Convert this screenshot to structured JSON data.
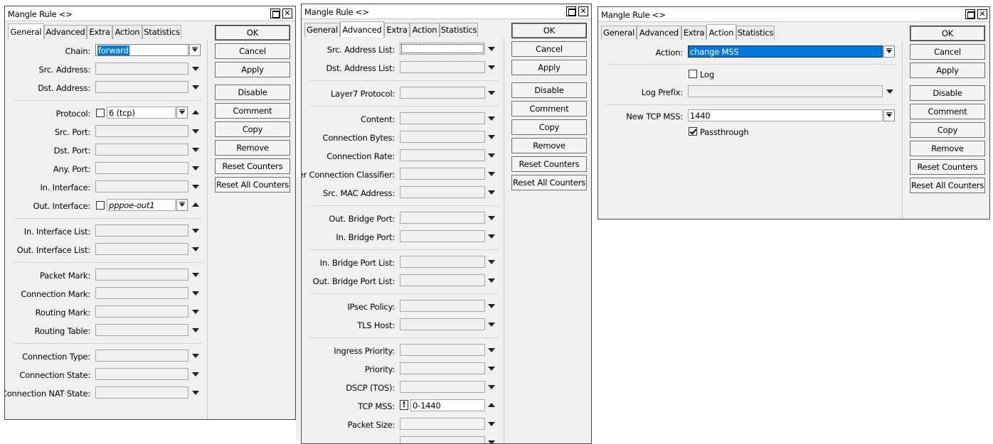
{
  "windows": [
    {
      "title": "Mangle Rule <>",
      "tabs": [
        "General",
        "Advanced",
        "Extra",
        "Action",
        "Statistics"
      ],
      "active_tab": "General",
      "fields": [
        {
          "label": "Chain:",
          "value": "forward",
          "kind": "select"
        },
        {
          "label": "Src. Address:",
          "value": "",
          "kind": "dropdown"
        },
        {
          "label": "Dst. Address:",
          "value": "",
          "kind": "dropdown"
        },
        {
          "label": "Protocol:",
          "value": "6 (tcp)",
          "kind": "neg-select"
        },
        {
          "label": "Src. Port:",
          "value": "",
          "kind": "dropdown"
        },
        {
          "label": "Dst. Port:",
          "value": "",
          "kind": "dropdown"
        },
        {
          "label": "Any. Port:",
          "value": "",
          "kind": "dropdown"
        },
        {
          "label": "In. Interface:",
          "value": "",
          "kind": "dropdown"
        },
        {
          "label": "Out. Interface:",
          "value": "pppoe-out1",
          "kind": "neg-select"
        },
        {
          "label": "In. Interface List:",
          "value": "",
          "kind": "dropdown"
        },
        {
          "label": "Out. Interface List:",
          "value": "",
          "kind": "dropdown"
        },
        {
          "label": "Packet Mark:",
          "value": "",
          "kind": "dropdown"
        },
        {
          "label": "Connection Mark:",
          "value": "",
          "kind": "dropdown"
        },
        {
          "label": "Routing Mark:",
          "value": "",
          "kind": "dropdown"
        },
        {
          "label": "Routing Table:",
          "value": "",
          "kind": "dropdown"
        },
        {
          "label": "Connection Type:",
          "value": "",
          "kind": "dropdown"
        },
        {
          "label": "Connection State:",
          "value": "",
          "kind": "dropdown"
        },
        {
          "label": "Connection NAT State:",
          "value": "",
          "kind": "dropdown"
        }
      ],
      "buttons": [
        "OK",
        "Cancel",
        "Apply",
        "Disable",
        "Comment",
        "Copy",
        "Remove",
        "Reset Counters",
        "Reset All Counters"
      ]
    },
    {
      "title": "Mangle Rule <>",
      "tabs": [
        "General",
        "Advanced",
        "Extra",
        "Action",
        "Statistics"
      ],
      "active_tab": "Advanced",
      "fields": [
        {
          "label": "Src. Address List:",
          "value": "",
          "kind": "dropdown"
        },
        {
          "label": "Dst. Address List:",
          "value": "",
          "kind": "dropdown"
        },
        {
          "label": "Layer7 Protocol:",
          "value": "",
          "kind": "dropdown"
        },
        {
          "label": "Content:",
          "value": "",
          "kind": "dropdown"
        },
        {
          "label": "Connection Bytes:",
          "value": "",
          "kind": "dropdown"
        },
        {
          "label": "Connection Rate:",
          "value": "",
          "kind": "dropdown"
        },
        {
          "label": "Per Connection Classifier:",
          "value": "",
          "kind": "dropdown"
        },
        {
          "label": "Src. MAC Address:",
          "value": "",
          "kind": "dropdown"
        },
        {
          "label": "Out. Bridge Port:",
          "value": "",
          "kind": "dropdown"
        },
        {
          "label": "In. Bridge Port:",
          "value": "",
          "kind": "dropdown"
        },
        {
          "label": "In. Bridge Port List:",
          "value": "",
          "kind": "dropdown"
        },
        {
          "label": "Out. Bridge Port List:",
          "value": "",
          "kind": "dropdown"
        },
        {
          "label": "IPsec Policy:",
          "value": "",
          "kind": "dropdown"
        },
        {
          "label": "TLS Host:",
          "value": "",
          "kind": "dropdown"
        },
        {
          "label": "Ingress Priority:",
          "value": "",
          "kind": "dropdown"
        },
        {
          "label": "Priority:",
          "value": "",
          "kind": "dropdown"
        },
        {
          "label": "DSCP (TOS):",
          "value": "",
          "kind": "dropdown"
        },
        {
          "label": "TCP MSS:",
          "value": "0-1440",
          "kind": "negated-text",
          "negate_glyph": "!"
        },
        {
          "label": "Packet Size:",
          "value": "",
          "kind": "dropdown"
        }
      ],
      "buttons": [
        "OK",
        "Cancel",
        "Apply",
        "Disable",
        "Comment",
        "Copy",
        "Remove",
        "Reset Counters",
        "Reset All Counters"
      ]
    },
    {
      "title": "Mangle Rule <>",
      "tabs": [
        "General",
        "Advanced",
        "Extra",
        "Action",
        "Statistics"
      ],
      "active_tab": "Action",
      "fields": [
        {
          "label": "Action:",
          "value": "change MSS",
          "kind": "select"
        },
        {
          "label": "Log",
          "value": "unchecked",
          "kind": "checkbox"
        },
        {
          "label": "Log Prefix:",
          "value": "",
          "kind": "dropdown"
        },
        {
          "label": "New TCP MSS:",
          "value": "1440",
          "kind": "select"
        },
        {
          "label": "Passthrough",
          "value": "checked",
          "kind": "checkbox"
        }
      ],
      "buttons": [
        "OK",
        "Cancel",
        "Apply",
        "Disable",
        "Comment",
        "Copy",
        "Remove",
        "Reset Counters",
        "Reset All Counters"
      ]
    }
  ]
}
